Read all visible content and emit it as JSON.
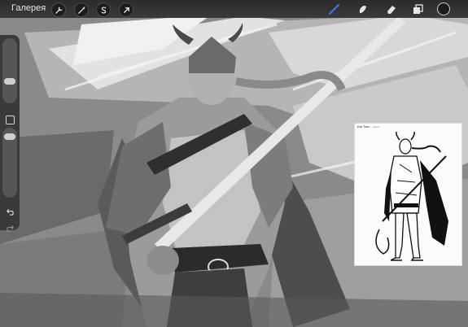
{
  "toolbar": {
    "gallery_label": "Галерея",
    "left_tools": [
      "wrench-icon",
      "magic-wand-icon",
      "selection-s-icon",
      "transform-arrow-icon"
    ],
    "right_tools": [
      "brush-icon",
      "smudge-icon",
      "eraser-icon",
      "layers-icon"
    ],
    "active_color": "#1c1c1c",
    "brush_color": "#3d7bf0"
  },
  "sidebar": {
    "buttons": [
      "size-slider",
      "modify-square-button",
      "opacity-slider",
      "undo-arrow-icon",
      "redo-arrow-icon"
    ]
  },
  "reference": {
    "title": "Kai Tonn",
    "subtitle": "sketch"
  }
}
